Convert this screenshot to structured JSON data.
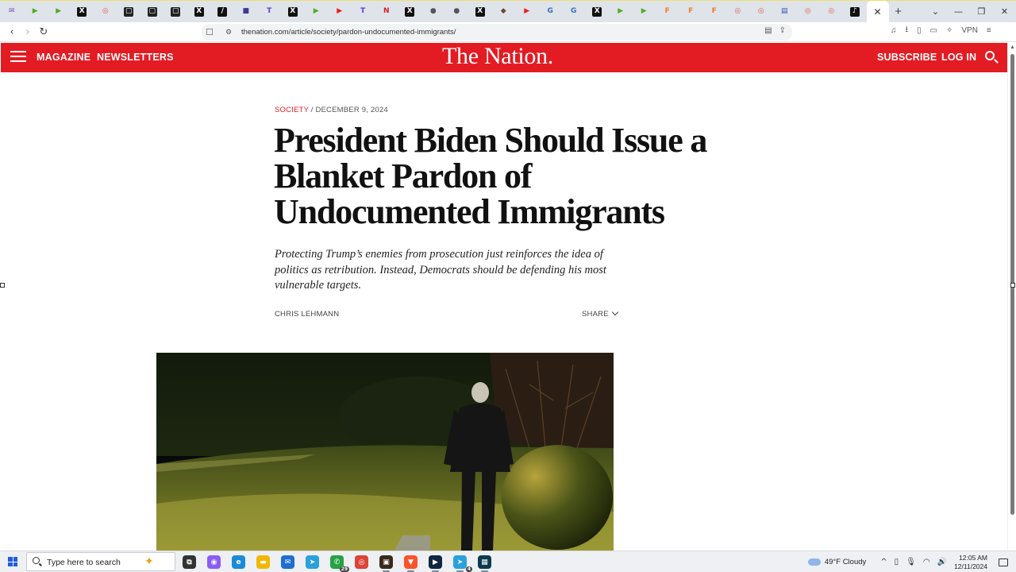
{
  "browser": {
    "tabs": [
      {
        "icon": "mail-icon",
        "glyph": "✉",
        "color": "#6b4fbb"
      },
      {
        "icon": "rumble-icon",
        "glyph": "▶",
        "color": "#4fae1f"
      },
      {
        "icon": "rumble-icon",
        "glyph": "▶",
        "color": "#4fae1f"
      },
      {
        "icon": "x-icon",
        "glyph": "X",
        "color": "#111111"
      },
      {
        "icon": "target-icon",
        "glyph": "◎",
        "color": "#e05a4a"
      },
      {
        "icon": "page-icon",
        "glyph": "▢",
        "color": "#222222"
      },
      {
        "icon": "page-icon",
        "glyph": "▢",
        "color": "#222222"
      },
      {
        "icon": "page-icon",
        "glyph": "▢",
        "color": "#222222"
      },
      {
        "icon": "x-icon",
        "glyph": "X",
        "color": "#111111"
      },
      {
        "icon": "slash-icon",
        "glyph": "/",
        "color": "#111111"
      },
      {
        "icon": "news-icon",
        "glyph": "■",
        "color": "#3a3a8c"
      },
      {
        "icon": "truth-icon",
        "glyph": "T",
        "color": "#5b3fd6"
      },
      {
        "icon": "x-icon",
        "glyph": "X",
        "color": "#111111"
      },
      {
        "icon": "rumble-icon",
        "glyph": "▶",
        "color": "#4fae1f"
      },
      {
        "icon": "youtube-icon",
        "glyph": "▶",
        "color": "#e62117"
      },
      {
        "icon": "truth-icon",
        "glyph": "T",
        "color": "#5b3fd6"
      },
      {
        "icon": "netflix-icon",
        "glyph": "N",
        "color": "#d81f26"
      },
      {
        "icon": "x-icon",
        "glyph": "X",
        "color": "#111111"
      },
      {
        "icon": "globe-icon",
        "glyph": "●",
        "color": "#555555"
      },
      {
        "icon": "globe-icon",
        "glyph": "●",
        "color": "#555555"
      },
      {
        "icon": "x-icon",
        "glyph": "X",
        "color": "#111111"
      },
      {
        "icon": "seal-icon",
        "glyph": "◆",
        "color": "#6b4a2a"
      },
      {
        "icon": "youtube-icon",
        "glyph": "▶",
        "color": "#e62117"
      },
      {
        "icon": "gp-icon",
        "glyph": "G",
        "color": "#3b6fb5"
      },
      {
        "icon": "gp-icon",
        "glyph": "G",
        "color": "#3b6fb5"
      },
      {
        "icon": "x-icon",
        "glyph": "X",
        "color": "#111111"
      },
      {
        "icon": "rumble-icon",
        "glyph": "▶",
        "color": "#4fae1f"
      },
      {
        "icon": "rumble-icon",
        "glyph": "▶",
        "color": "#4fae1f"
      },
      {
        "icon": "f-icon",
        "glyph": "F",
        "color": "#f07d1a"
      },
      {
        "icon": "f-icon",
        "glyph": "F",
        "color": "#f07d1a"
      },
      {
        "icon": "f-icon",
        "glyph": "F",
        "color": "#f07d1a"
      },
      {
        "icon": "target-icon",
        "glyph": "◎",
        "color": "#e05a4a"
      },
      {
        "icon": "target-icon",
        "glyph": "◎",
        "color": "#e05a4a"
      },
      {
        "icon": "flag-icon",
        "glyph": "▤",
        "color": "#3355aa"
      },
      {
        "icon": "target-icon",
        "glyph": "◎",
        "color": "#e05a4a"
      },
      {
        "icon": "target-icon",
        "glyph": "◎",
        "color": "#e05a4a"
      },
      {
        "icon": "tiktok-icon",
        "glyph": "♪",
        "color": "#111111"
      }
    ],
    "url": "thenation.com/article/society/pardon-undocumented-immigrants/",
    "vpn_label": "VPN"
  },
  "site": {
    "menu_links": [
      "MAGAZINE",
      "NEWSLETTERS"
    ],
    "logo": "The Nation.",
    "subscribe": "SUBSCRIBE",
    "login": "LOG IN",
    "brand_color": "#e31b23"
  },
  "article": {
    "section": "SOCIETY",
    "date": "/ DECEMBER 9, 2024",
    "headline_lines": [
      "President Biden Should Issue a",
      "Blanket Pardon of",
      "Undocumented Immigrants"
    ],
    "dek": "Protecting Trump’s enemies from prosecution just reinforces the idea of politics as retribution. Instead, Democrats should be defending his most vulnerable targets.",
    "author": "CHRIS LEHMANN",
    "share": "SHARE"
  },
  "taskbar": {
    "search_placeholder": "Type here to search",
    "apps": [
      {
        "icon": "task-view-icon",
        "glyph": "⧉",
        "color": "#333333"
      },
      {
        "icon": "copilot-icon",
        "glyph": "◉",
        "color": "#8a5cf6"
      },
      {
        "icon": "edge-icon",
        "glyph": "e",
        "color": "#1b8ad8"
      },
      {
        "icon": "folder-icon",
        "glyph": "▬",
        "color": "#f2b705"
      },
      {
        "icon": "mail-icon",
        "glyph": "✉",
        "color": "#1f6fd0"
      },
      {
        "icon": "telegram-icon",
        "glyph": "➤",
        "color": "#2aa1da"
      },
      {
        "icon": "whatsapp-icon",
        "glyph": "✆",
        "color": "#25a244",
        "badge": "29"
      },
      {
        "icon": "chrome-icon",
        "glyph": "◎",
        "color": "#db4437"
      },
      {
        "icon": "app-icon",
        "glyph": "▣",
        "color": "#3a2a1a"
      },
      {
        "icon": "brave-icon",
        "glyph": "▼",
        "color": "#fb542b"
      },
      {
        "icon": "terminal-icon",
        "glyph": "▶",
        "color": "#0f2740"
      },
      {
        "icon": "telegram-icon",
        "glyph": "➤",
        "color": "#2aa1da",
        "badge": "4"
      },
      {
        "icon": "capture-icon",
        "glyph": "▦",
        "color": "#0b3b4f"
      }
    ],
    "weather": "49°F  Cloudy",
    "time": "12:05 AM",
    "date": "12/11/2024"
  }
}
